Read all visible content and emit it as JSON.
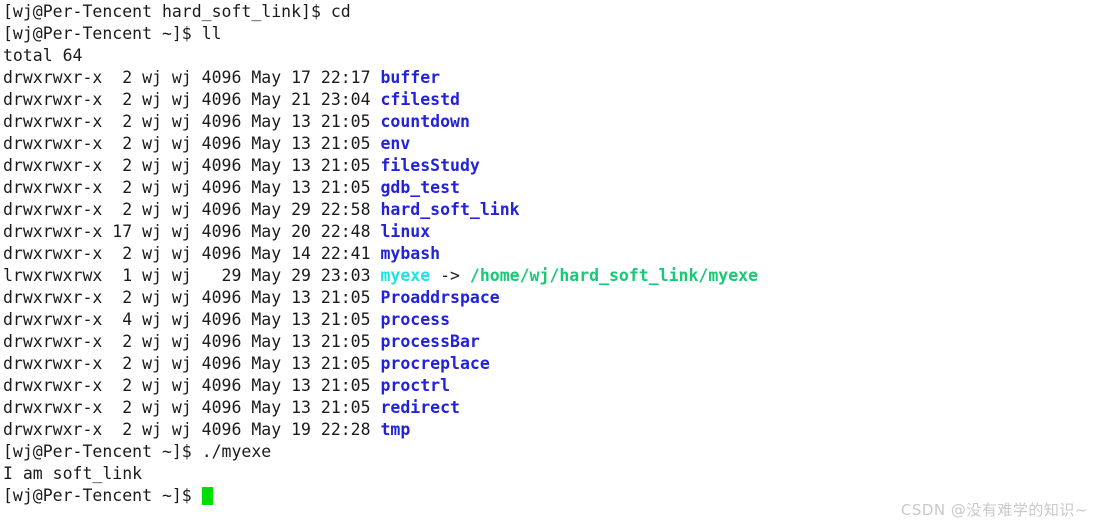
{
  "terminal": {
    "background_color": "#ffffff",
    "foreground_color": "#1a1a1a",
    "dir_color": "#2222dd",
    "symlink_color": "#1ae5e5",
    "symlink_target_color": "#18c974",
    "cursor_color": "#00e000",
    "prompt_home": "[wj@Per-Tencent ~]$ ",
    "prompt_hardsoftlink": "[wj@Per-Tencent hard_soft_link]$ ",
    "commands": {
      "cd": "cd",
      "ll": "ll",
      "run_myexe": "./myexe"
    },
    "total_line": "total 64",
    "program_output": "I am soft_link",
    "arrow": " -> ",
    "listing": [
      {
        "perms": "drwxrwxr-x",
        "links": " 2",
        "owner": "wj",
        "group": "wj",
        "size": "4096",
        "month": "May",
        "day": "17",
        "time": "22:17",
        "name": "buffer",
        "type": "dir"
      },
      {
        "perms": "drwxrwxr-x",
        "links": " 2",
        "owner": "wj",
        "group": "wj",
        "size": "4096",
        "month": "May",
        "day": "21",
        "time": "23:04",
        "name": "cfilestd",
        "type": "dir"
      },
      {
        "perms": "drwxrwxr-x",
        "links": " 2",
        "owner": "wj",
        "group": "wj",
        "size": "4096",
        "month": "May",
        "day": "13",
        "time": "21:05",
        "name": "countdown",
        "type": "dir"
      },
      {
        "perms": "drwxrwxr-x",
        "links": " 2",
        "owner": "wj",
        "group": "wj",
        "size": "4096",
        "month": "May",
        "day": "13",
        "time": "21:05",
        "name": "env",
        "type": "dir"
      },
      {
        "perms": "drwxrwxr-x",
        "links": " 2",
        "owner": "wj",
        "group": "wj",
        "size": "4096",
        "month": "May",
        "day": "13",
        "time": "21:05",
        "name": "filesStudy",
        "type": "dir"
      },
      {
        "perms": "drwxrwxr-x",
        "links": " 2",
        "owner": "wj",
        "group": "wj",
        "size": "4096",
        "month": "May",
        "day": "13",
        "time": "21:05",
        "name": "gdb_test",
        "type": "dir"
      },
      {
        "perms": "drwxrwxr-x",
        "links": " 2",
        "owner": "wj",
        "group": "wj",
        "size": "4096",
        "month": "May",
        "day": "29",
        "time": "22:58",
        "name": "hard_soft_link",
        "type": "dir"
      },
      {
        "perms": "drwxrwxr-x",
        "links": "17",
        "owner": "wj",
        "group": "wj",
        "size": "4096",
        "month": "May",
        "day": "20",
        "time": "22:48",
        "name": "linux",
        "type": "dir"
      },
      {
        "perms": "drwxrwxr-x",
        "links": " 2",
        "owner": "wj",
        "group": "wj",
        "size": "4096",
        "month": "May",
        "day": "14",
        "time": "22:41",
        "name": "mybash",
        "type": "dir"
      },
      {
        "perms": "lrwxrwxrwx",
        "links": " 1",
        "owner": "wj",
        "group": "wj",
        "size": "  29",
        "month": "May",
        "day": "29",
        "time": "23:03",
        "name": "myexe",
        "type": "symlink",
        "target": "/home/wj/hard_soft_link/myexe"
      },
      {
        "perms": "drwxrwxr-x",
        "links": " 2",
        "owner": "wj",
        "group": "wj",
        "size": "4096",
        "month": "May",
        "day": "13",
        "time": "21:05",
        "name": "Proaddrspace",
        "type": "dir"
      },
      {
        "perms": "drwxrwxr-x",
        "links": " 4",
        "owner": "wj",
        "group": "wj",
        "size": "4096",
        "month": "May",
        "day": "13",
        "time": "21:05",
        "name": "process",
        "type": "dir"
      },
      {
        "perms": "drwxrwxr-x",
        "links": " 2",
        "owner": "wj",
        "group": "wj",
        "size": "4096",
        "month": "May",
        "day": "13",
        "time": "21:05",
        "name": "processBar",
        "type": "dir"
      },
      {
        "perms": "drwxrwxr-x",
        "links": " 2",
        "owner": "wj",
        "group": "wj",
        "size": "4096",
        "month": "May",
        "day": "13",
        "time": "21:05",
        "name": "procreplace",
        "type": "dir"
      },
      {
        "perms": "drwxrwxr-x",
        "links": " 2",
        "owner": "wj",
        "group": "wj",
        "size": "4096",
        "month": "May",
        "day": "13",
        "time": "21:05",
        "name": "proctrl",
        "type": "dir"
      },
      {
        "perms": "drwxrwxr-x",
        "links": " 2",
        "owner": "wj",
        "group": "wj",
        "size": "4096",
        "month": "May",
        "day": "13",
        "time": "21:05",
        "name": "redirect",
        "type": "dir"
      },
      {
        "perms": "drwxrwxr-x",
        "links": " 2",
        "owner": "wj",
        "group": "wj",
        "size": "4096",
        "month": "May",
        "day": "19",
        "time": "22:28",
        "name": "tmp",
        "type": "dir"
      }
    ]
  },
  "watermark": "CSDN @没有难学的知识~"
}
